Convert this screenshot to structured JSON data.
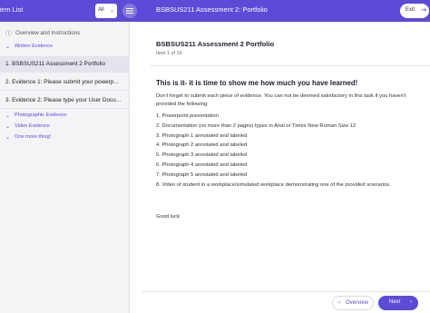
{
  "topbar": {
    "title": "Item List",
    "filter_value": "All",
    "header_title": "BSBSUS211 Assessment 2: Portfolio",
    "exit_label": "Exit"
  },
  "sidebar": {
    "overview_label": "Overview and Instructions",
    "sections": {
      "written": "Written Evidence",
      "photographic": "Photographic Evidence",
      "video": "Video Evidence",
      "more": "One more thing!"
    },
    "items": [
      {
        "label": "1. BSBSUS211 Assessment 2 Portfolio",
        "active": true
      },
      {
        "label": "2. Evidence 1: Please submit your powerp..."
      },
      {
        "label": "3. Evidence 2: Please type your User Docu..."
      }
    ]
  },
  "main": {
    "title": "BSBSUS211 Assessment 2 Portfolio",
    "item_count": "Item 1 of 19",
    "heading": "This is it- it is time to show me how much you have learned!",
    "paragraph": "Don't forget to submit each piece of evidence. You can not be deemed satisfactory in this task if you haven't provided the following:",
    "list": [
      "1. Powerpoint presentation",
      "2. Documentation (no more than 2 pages) types in Arial or Times New Roman Size 12",
      "3. Photograph 1 annotated and labeled",
      "4. Photograph 2 annotated and labeled",
      "5. Photograph 3 annotated and labeled",
      "6. Photograph 4 annotated and labeled",
      "7. Photograph 5 annotated and labeled",
      "8. Video of student in a workplace/simulated workplace demonstrating one of the provided scenarios."
    ],
    "closing": "Good luck"
  },
  "footer": {
    "overview_label": "Overview",
    "next_label": "Next"
  },
  "colors": {
    "accent": "#5b4bd6",
    "sidebar_bg": "#f4f4f7"
  },
  "icons": {
    "filter_chevron": "chevron-down-icon",
    "menu": "hamburger-menu-icon",
    "exit": "exit-icon",
    "overview": "info-circle-icon",
    "section": "chevron-down-icon",
    "item_menu": "more-vertical-icon",
    "prev": "chevron-left-icon",
    "next": "chevron-right-icon"
  }
}
